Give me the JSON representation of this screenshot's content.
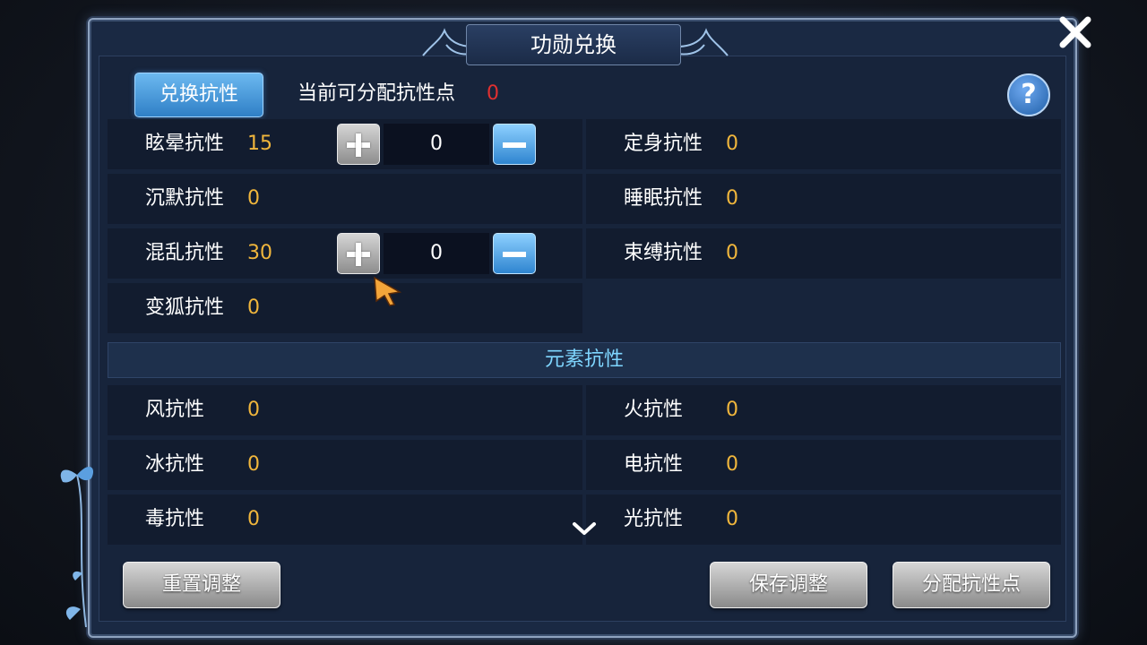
{
  "dialog": {
    "title": "功勋兑换",
    "close_icon": "close-icon"
  },
  "header": {
    "tab_label": "兑换抗性",
    "points_label": "当前可分配抗性点",
    "points_value": "0",
    "help_label": "?"
  },
  "control_resistances": {
    "rows": [
      {
        "left_label": "眩晕抗性",
        "left_value": "15",
        "has_stepper": true,
        "stepper_value": "0",
        "right_label": "定身抗性",
        "right_value": "0"
      },
      {
        "left_label": "沉默抗性",
        "left_value": "0",
        "has_stepper": false,
        "right_label": "睡眠抗性",
        "right_value": "0"
      },
      {
        "left_label": "混乱抗性",
        "left_value": "30",
        "has_stepper": true,
        "stepper_value": "0",
        "right_label": "束缚抗性",
        "right_value": "0"
      },
      {
        "left_label": "变狐抗性",
        "left_value": "0",
        "has_stepper": false,
        "right_label": "",
        "right_value": ""
      }
    ]
  },
  "element_section": {
    "title": "元素抗性",
    "rows": [
      {
        "left_label": "风抗性",
        "left_value": "0",
        "right_label": "火抗性",
        "right_value": "0"
      },
      {
        "left_label": "冰抗性",
        "left_value": "0",
        "right_label": "电抗性",
        "right_value": "0"
      },
      {
        "left_label": "毒抗性",
        "left_value": "0",
        "right_label": "光抗性",
        "right_value": "0"
      }
    ]
  },
  "footer": {
    "reset_label": "重置调整",
    "save_label": "保存调整",
    "assign_label": "分配抗性点"
  },
  "colors": {
    "value": "#f0b63c",
    "points_value": "#e03030",
    "section_title": "#7fd6ff"
  }
}
